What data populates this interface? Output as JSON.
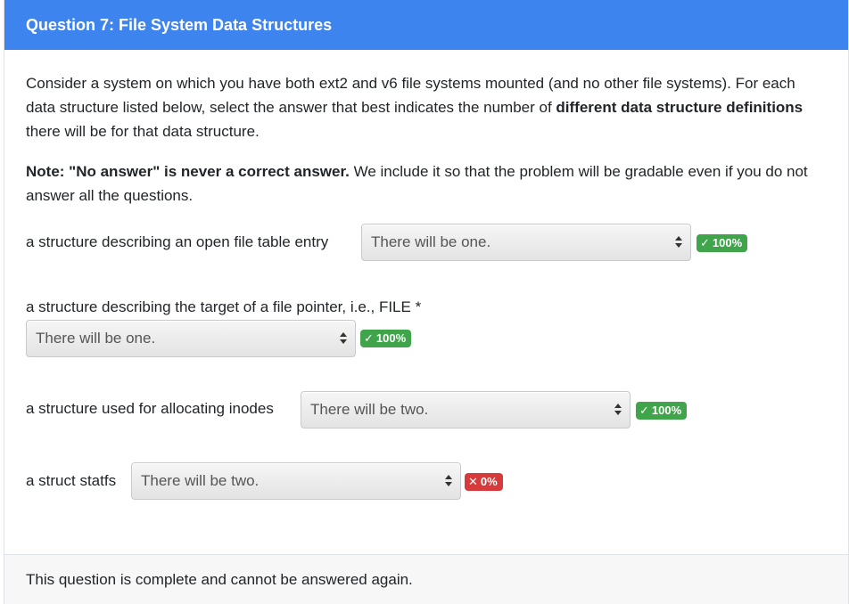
{
  "header": {
    "title": "Question 7: File System Data Structures"
  },
  "intro": {
    "p1_a": "Consider a system on which you have both ext2 and v6 file systems mounted (and no other file systems). For each data structure listed below, select the answer that best indicates the number of ",
    "p1_bold": "different data structure definitions",
    "p1_b": " there will be for that data structure.",
    "note_bold": "Note: \"No answer\" is never a correct answer.",
    "note_rest": " We include it so that the problem will be gradable even if you do not answer all the questions."
  },
  "questions": [
    {
      "label": "a structure describing an open file table entry",
      "selected": "There will be one.",
      "result": "100%",
      "correct": true
    },
    {
      "label": "a structure describing the target of a file pointer, i.e., FILE *",
      "selected": "There will be one.",
      "result": "100%",
      "correct": true
    },
    {
      "label": "a structure used for allocating inodes",
      "selected": "There will be two.",
      "result": "100%",
      "correct": true
    },
    {
      "label": "a struct statfs",
      "selected": "There will be two.",
      "result": "0%",
      "correct": false
    }
  ],
  "icons": {
    "check": "✓",
    "cross": "✕"
  },
  "colors": {
    "header_bg": "#3d84ef",
    "badge_correct": "#3fa44a",
    "badge_incorrect": "#d63a3a"
  },
  "footer": {
    "text": "This question is complete and cannot be answered again."
  }
}
